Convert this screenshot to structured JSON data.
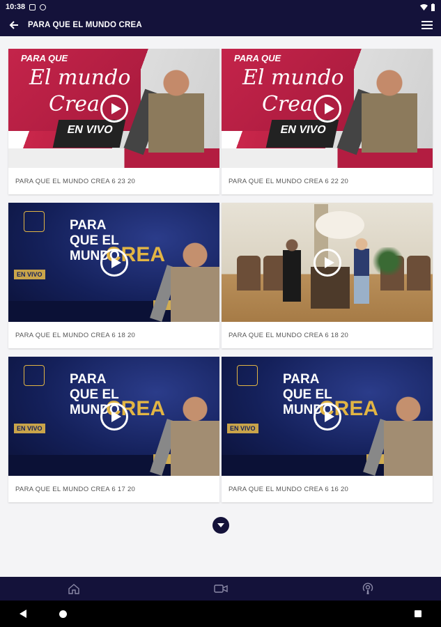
{
  "status_bar": {
    "time": "10:38",
    "icons": [
      "wifi-icon",
      "battery-icon"
    ]
  },
  "app_bar": {
    "title": "PARA QUE EL MUNDO CREA",
    "back_icon": "arrow-left-icon",
    "menu_icon": "hamburger-menu-icon"
  },
  "videos": [
    {
      "title": "PARA QUE EL MUNDO CREA 6 23 20",
      "thumb": "red-banner"
    },
    {
      "title": "PARA QUE EL MUNDO CREA 6 22 20",
      "thumb": "red-banner"
    },
    {
      "title": "PARA QUE EL MUNDO CREA 6 18 20",
      "thumb": "blue-banner"
    },
    {
      "title": "PARA QUE EL MUNDO CREA 6 18 20",
      "thumb": "church-stage"
    },
    {
      "title": "PARA QUE EL MUNDO CREA 6 17 20",
      "thumb": "blue-banner"
    },
    {
      "title": "PARA QUE EL MUNDO CREA 6 16 20",
      "thumb": "blue-banner"
    }
  ],
  "thumb_text": {
    "red": {
      "line1": "PARA QUE",
      "line2": "El mundo",
      "line3": "Crea",
      "live": "EN VIVO"
    },
    "blue": {
      "big": "PARA QUE EL MUNDO",
      "crea": "CREA",
      "live": "EN VIVO"
    }
  },
  "colors": {
    "app_bar": "#14123a",
    "accent_red": "#c4244a",
    "accent_gold": "#e2b544"
  },
  "bottom_nav": [
    "home-icon",
    "video-camera-icon",
    "podcast-icon"
  ],
  "system_nav": [
    "back-triangle-icon",
    "home-circle-icon",
    "recents-square-icon"
  ]
}
